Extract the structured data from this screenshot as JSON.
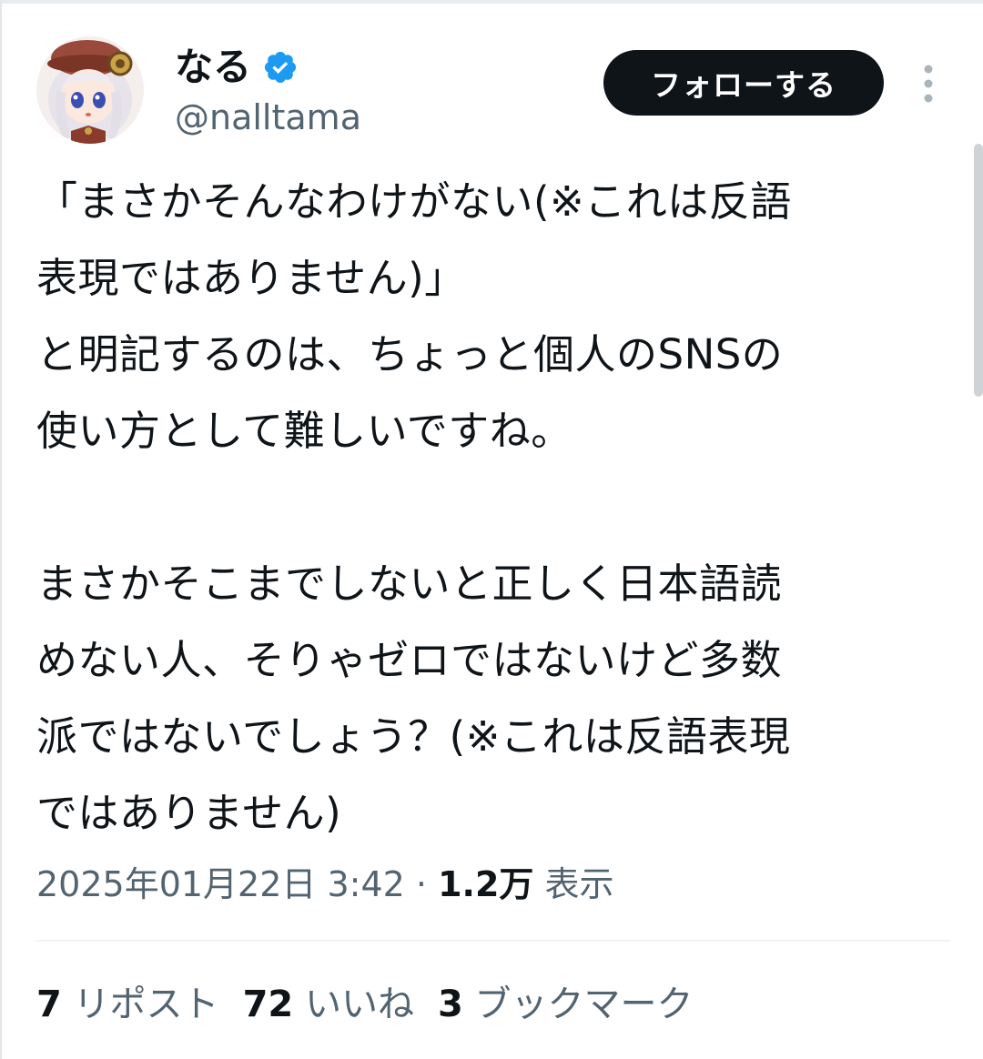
{
  "tweet": {
    "author": {
      "display_name": "なる",
      "handle": "@nalltama",
      "verified": true
    },
    "follow_label": "フォローする",
    "text": "「まさかそんなわけがない(※これは反語\n表現ではありません)」\nと明記するのは、ちょっと個人のSNSの\n使い方として難しいですね。\n\nまさかそこまでしないと正しく日本語読\nめない人、そりゃゼロではないけど多数\n派ではないでしょう？(※これは反語表現\nではありません)",
    "meta": {
      "timestamp": "2025年01月22日 3:42",
      "separator": "·",
      "views_count": "1.2万",
      "views_label": "表示"
    },
    "stats": {
      "reposts_count": "7",
      "reposts_label": "リポスト",
      "likes_count": "72",
      "likes_label": "いいね",
      "bookmarks_count": "3",
      "bookmarks_label": "ブックマーク"
    }
  },
  "icons": {
    "verified": "verified-badge-icon",
    "more": "more-options-icon"
  },
  "colors": {
    "text_primary": "#0f1419",
    "text_secondary": "#536471",
    "verified_blue": "#1d9bf0",
    "follow_button_bg": "#0f1419",
    "divider": "#eff3f4"
  }
}
